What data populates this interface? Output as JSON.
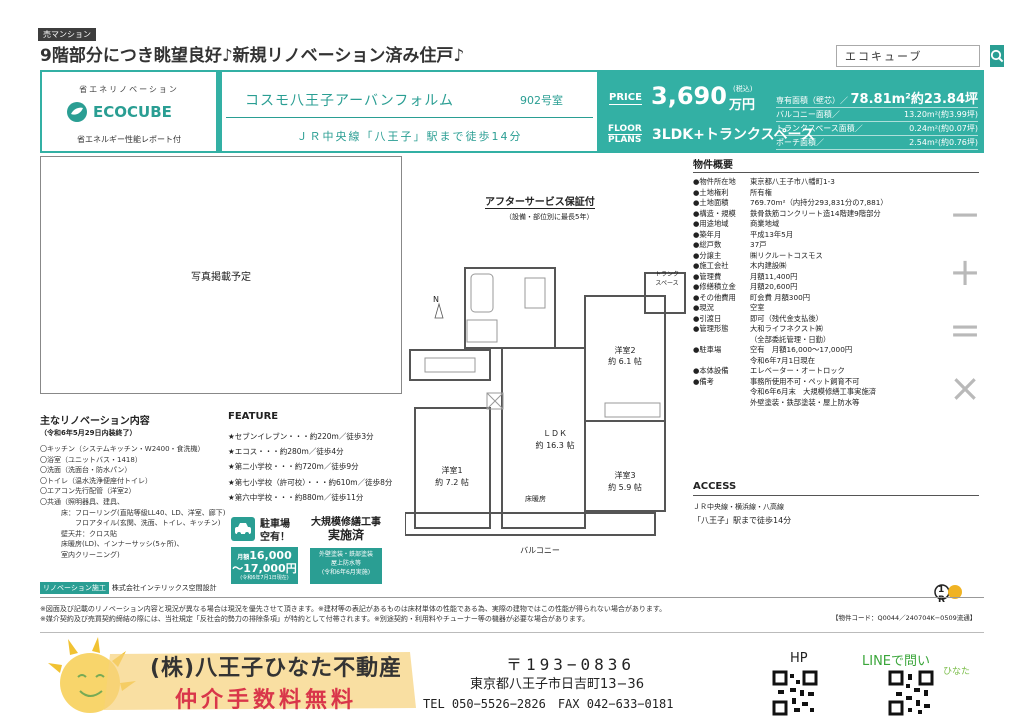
{
  "header": {
    "badge": "売マンション",
    "headline": "9階部分につき眺望良好♪新規リノベーション済み住戸♪",
    "search_value": "エコキューブ"
  },
  "logo": {
    "top": "省エネリノベーション",
    "name": "ECOCUBE",
    "sub": "省エネルギー性能レポート付"
  },
  "building": {
    "name": "コスモ八王子アーバンフォルム",
    "room": "902号室",
    "station": "ＪＲ中央線「八王子」駅まで徒歩14分"
  },
  "price": {
    "label": "PRICE",
    "value": "3,690",
    "tax": "(税込)",
    "unit": "万円",
    "floor_label1": "FLOOR",
    "floor_label2": "PLANS",
    "plan": "3LDK+トランクスペース"
  },
  "areas": [
    {
      "k": "専有面積（壁芯）／",
      "v": "78.81m²約23.84坪"
    },
    {
      "k": "バルコニー面積／",
      "v": "13.20m²(約3.99坪)"
    },
    {
      "k": "トランクスペース面積／",
      "v": "0.24m²(約0.07坪)"
    },
    {
      "k": "ポーチ面積／",
      "v": "2.54m²(約0.76坪)"
    }
  ],
  "photo_label": "写真掲載予定",
  "renovation": {
    "title": "主なリノベーション内容",
    "date": "（令和6年5月29日内装終了）",
    "items": [
      "〇キッチン（システムキッチン・W2400・食洗機）",
      "〇浴室（ユニットバス・1418）",
      "〇洗面（洗面台・防水パン）",
      "〇トイレ（温水洗浄便座付トイレ）",
      "〇エアコン先行配管（洋室2）",
      "〇共通（照明器具、建具、",
      "　　　床：フローリング(直貼等級LL40、LD、洋室、廊下)",
      "　　　　　フロアタイル(玄関、洗面、トイレ、キッチン)",
      "　　　壁天井：クロス貼",
      "　　　床暖房(LD)、インナーサッシ(5ヶ所)、",
      "　　　室内クリーニング)"
    ],
    "company_tag": "リノベーション施工",
    "company": "株式会社インテリックス空間設計"
  },
  "feature": {
    "title": "FEATURE",
    "items": [
      "★セブンイレブン・・・約220m／徒歩3分",
      "★エコス・・・約280m／徒歩4分",
      "★第二小学校・・・約720m／徒歩9分",
      "★第七小学校（許可校）・・・約610m／徒歩8分",
      "★第六中学校・・・約880m／徒歩11分"
    ],
    "parking_title1": "駐車場",
    "parking_title2": "空有！",
    "parking_price1": "16,000",
    "parking_price2": "〜17,000円",
    "parking_prefix": "月額",
    "parking_note": "(令和6年7月1日現在)",
    "repair_title1": "大規模修繕工事",
    "repair_title2": "実施済",
    "repair_l1": "外壁塗装・鉄部塗装",
    "repair_l2": "屋上防水等",
    "repair_l3": "(令和6年6月実施)"
  },
  "floorplan": {
    "after_title": "アフターサービス保証付",
    "after_sub": "（設備・部位別に最長5年）",
    "rooms": [
      {
        "name": "洋室2",
        "size": "約 6.1 帖"
      },
      {
        "name": "ＬＤＫ",
        "size": "約 16.3 帖"
      },
      {
        "name": "洋室1",
        "size": "約 7.2 帖"
      },
      {
        "name": "洋室3",
        "size": "約 5.9 帖"
      }
    ],
    "trunk": "トランク",
    "trunk2": "スペース",
    "heating": "床暖房",
    "balcony": "バルコニー",
    "north": "N"
  },
  "spec": {
    "title": "物件概要",
    "rows": [
      {
        "k": "●物件所在地",
        "v": "東京都八王子市八幡町1-3"
      },
      {
        "k": "●土地権利",
        "v": "所有権"
      },
      {
        "k": "●土地面積",
        "v": "769.70m²（内持分293,831分の7,881）"
      },
      {
        "k": "●構造・規模",
        "v": "鉄骨鉄筋コンクリート造14階建9階部分"
      },
      {
        "k": "●用途地域",
        "v": "商業地域"
      },
      {
        "k": "●築年月",
        "v": "平成13年5月"
      },
      {
        "k": "●総戸数",
        "v": "37戸"
      },
      {
        "k": "●分譲主",
        "v": "㈱リクルートコスモス"
      },
      {
        "k": "●施工会社",
        "v": "木内建設㈱"
      },
      {
        "k": "●管理費",
        "v": "月額11,400円"
      },
      {
        "k": "●修繕積立金",
        "v": "月額20,600円"
      },
      {
        "k": "●その他費用",
        "v": "町会費 月額300円"
      },
      {
        "k": "●現況",
        "v": "空室"
      },
      {
        "k": "●引渡日",
        "v": "即可（残代金支払後）"
      },
      {
        "k": "●管理形態",
        "v": "大和ライフネクスト㈱"
      },
      {
        "k": "",
        "v": "（全部委託管理・日勤）"
      },
      {
        "k": "●駐車場",
        "v": "空有　月額16,000〜17,000円"
      },
      {
        "k": "",
        "v": "令和6年7月1日現在"
      },
      {
        "k": "●本体設備",
        "v": "エレベーター・オートロック"
      },
      {
        "k": "●備考",
        "v": "事務所使用不可・ペット飼育不可"
      },
      {
        "k": "",
        "v": "令和6年6月末　大規模修繕工事実施済"
      },
      {
        "k": "",
        "v": "外壁塗装・鉄部塗装・屋上防水等"
      }
    ]
  },
  "access": {
    "title": "ACCESS",
    "line1": "ＪＲ中央線・横浜線・八高線",
    "line2": "「八王子」駅まで徒歩14分"
  },
  "side_icons": [
    "−",
    "+",
    "=",
    "×"
  ],
  "r_logo": "1 R",
  "code": "【物件コード：Q0044／240704K−0509流通】",
  "notes": [
    "※図面及び記載のリノベーション内容と現況が異なる場合は現況を優先させて頂きます。※建材等の表記があるものは床材単体の性能である為、実際の建物ではこの性能が得られない場合があります。",
    "※媒介契約及び売買契約締結の際には、当社規定「反社会的勢力の排除条項」が特約として付帯されます。※別途契約・利用料やチューナー等の機器が必要な場合があります。"
  ],
  "footer": {
    "company": "(株)八王子ひなた不動産",
    "free": "仲介手数料無料",
    "zip": "〒193−0836",
    "address": "東京都八王子市日吉町13−36",
    "tel": "TEL 050−5526−2826　FAX 042−633−0181",
    "hp": "HP",
    "line": "LINEで問い",
    "hinata": "ひなた"
  }
}
